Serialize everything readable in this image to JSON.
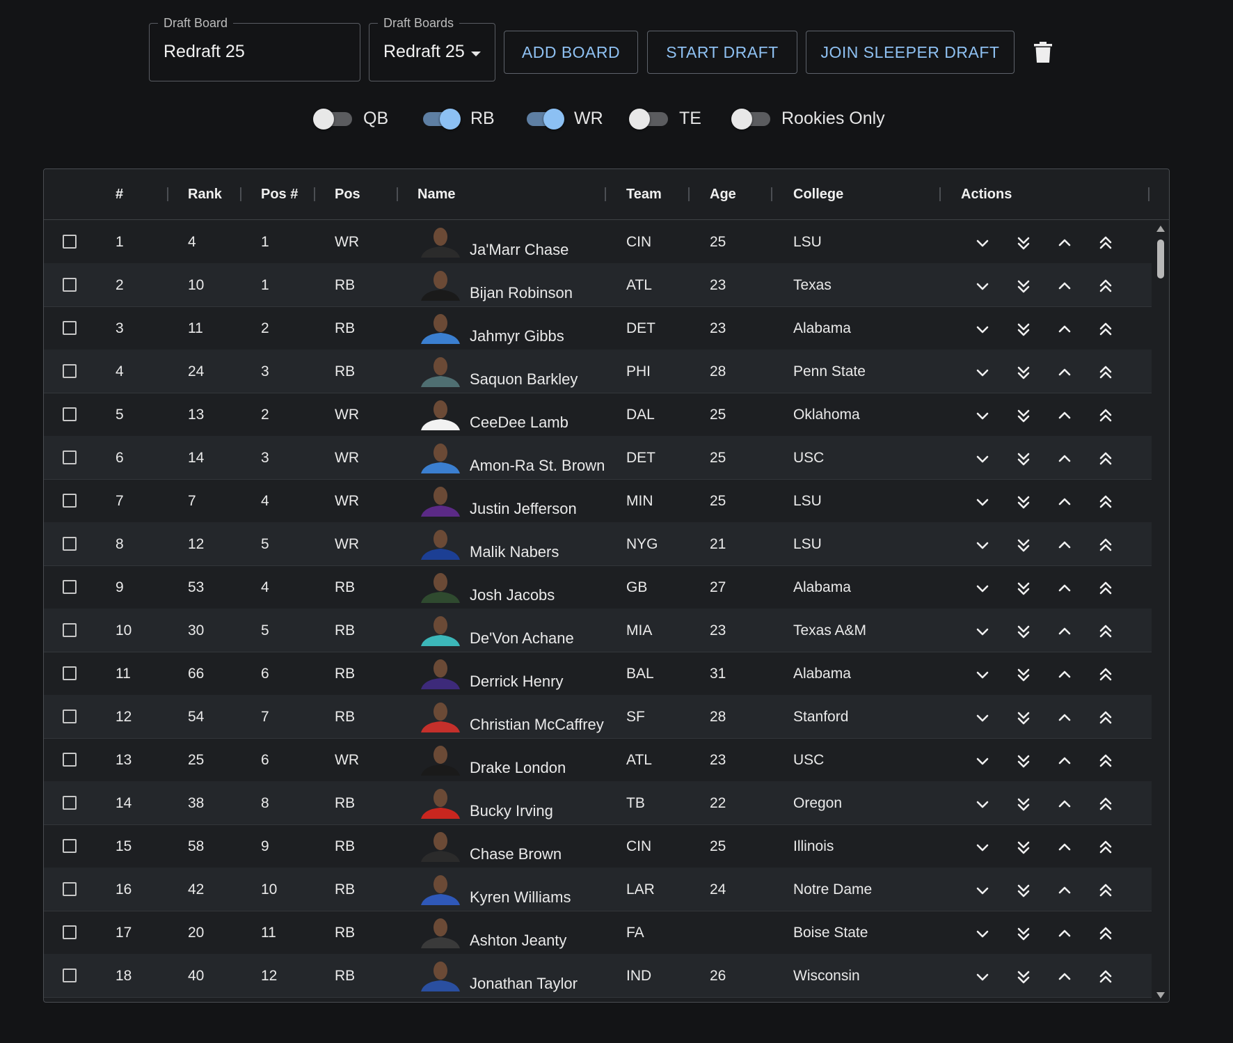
{
  "toolbar": {
    "draft_board_label": "Draft Board",
    "draft_board_value": "Redraft 25",
    "draft_boards_label": "Draft Boards",
    "draft_boards_value": "Redraft 25",
    "add_board": "ADD BOARD",
    "start_draft": "START DRAFT",
    "join_sleeper": "JOIN SLEEPER DRAFT",
    "delete_icon": "trash-icon"
  },
  "filters": [
    {
      "label": "QB",
      "on": false
    },
    {
      "label": "RB",
      "on": true
    },
    {
      "label": "WR",
      "on": true
    },
    {
      "label": "TE",
      "on": false
    },
    {
      "label": "Rookies Only",
      "on": false
    }
  ],
  "table": {
    "headers": [
      "#",
      "Rank",
      "Pos #",
      "Pos",
      "Name",
      "Team",
      "Age",
      "College",
      "Actions"
    ],
    "action_icons": [
      "chevron-down-icon",
      "double-chevron-down-icon",
      "chevron-up-icon",
      "double-chevron-up-icon"
    ],
    "rows": [
      {
        "num": "1",
        "rank": "4",
        "posnum": "1",
        "pos": "WR",
        "name": "Ja'Marr Chase",
        "team": "CIN",
        "age": "25",
        "college": "LSU",
        "jersey": "#2b2b2b"
      },
      {
        "num": "2",
        "rank": "10",
        "posnum": "1",
        "pos": "RB",
        "name": "Bijan Robinson",
        "team": "ATL",
        "age": "23",
        "college": "Texas",
        "jersey": "#1a1a1a"
      },
      {
        "num": "3",
        "rank": "11",
        "posnum": "2",
        "pos": "RB",
        "name": "Jahmyr Gibbs",
        "team": "DET",
        "age": "23",
        "college": "Alabama",
        "jersey": "#3b7fd0"
      },
      {
        "num": "4",
        "rank": "24",
        "posnum": "3",
        "pos": "RB",
        "name": "Saquon Barkley",
        "team": "PHI",
        "age": "28",
        "college": "Penn State",
        "jersey": "#4f6f72"
      },
      {
        "num": "5",
        "rank": "13",
        "posnum": "2",
        "pos": "WR",
        "name": "CeeDee Lamb",
        "team": "DAL",
        "age": "25",
        "college": "Oklahoma",
        "jersey": "#f2f2f2"
      },
      {
        "num": "6",
        "rank": "14",
        "posnum": "3",
        "pos": "WR",
        "name": "Amon-Ra St. Brown",
        "team": "DET",
        "age": "25",
        "college": "USC",
        "jersey": "#3b7fd0"
      },
      {
        "num": "7",
        "rank": "7",
        "posnum": "4",
        "pos": "WR",
        "name": "Justin Jefferson",
        "team": "MIN",
        "age": "25",
        "college": "LSU",
        "jersey": "#5b2a86"
      },
      {
        "num": "8",
        "rank": "12",
        "posnum": "5",
        "pos": "WR",
        "name": "Malik Nabers",
        "team": "NYG",
        "age": "21",
        "college": "LSU",
        "jersey": "#1c3f94"
      },
      {
        "num": "9",
        "rank": "53",
        "posnum": "4",
        "pos": "RB",
        "name": "Josh Jacobs",
        "team": "GB",
        "age": "27",
        "college": "Alabama",
        "jersey": "#2f4a2f"
      },
      {
        "num": "10",
        "rank": "30",
        "posnum": "5",
        "pos": "RB",
        "name": "De'Von Achane",
        "team": "MIA",
        "age": "23",
        "college": "Texas A&M",
        "jersey": "#3cb7b9"
      },
      {
        "num": "11",
        "rank": "66",
        "posnum": "6",
        "pos": "RB",
        "name": "Derrick Henry",
        "team": "BAL",
        "age": "31",
        "college": "Alabama",
        "jersey": "#3d2a7a"
      },
      {
        "num": "12",
        "rank": "54",
        "posnum": "7",
        "pos": "RB",
        "name": "Christian McCaffrey",
        "team": "SF",
        "age": "28",
        "college": "Stanford",
        "jersey": "#c4302b"
      },
      {
        "num": "13",
        "rank": "25",
        "posnum": "6",
        "pos": "WR",
        "name": "Drake London",
        "team": "ATL",
        "age": "23",
        "college": "USC",
        "jersey": "#1a1a1a"
      },
      {
        "num": "14",
        "rank": "38",
        "posnum": "8",
        "pos": "RB",
        "name": "Bucky Irving",
        "team": "TB",
        "age": "22",
        "college": "Oregon",
        "jersey": "#c8261f"
      },
      {
        "num": "15",
        "rank": "58",
        "posnum": "9",
        "pos": "RB",
        "name": "Chase Brown",
        "team": "CIN",
        "age": "25",
        "college": "Illinois",
        "jersey": "#2b2b2b"
      },
      {
        "num": "16",
        "rank": "42",
        "posnum": "10",
        "pos": "RB",
        "name": "Kyren Williams",
        "team": "LAR",
        "age": "24",
        "college": "Notre Dame",
        "jersey": "#2f58b8"
      },
      {
        "num": "17",
        "rank": "20",
        "posnum": "11",
        "pos": "RB",
        "name": "Ashton Jeanty",
        "team": "FA",
        "age": "",
        "college": "Boise State",
        "jersey": "#3a3a3a"
      },
      {
        "num": "18",
        "rank": "40",
        "posnum": "12",
        "pos": "RB",
        "name": "Jonathan Taylor",
        "team": "IND",
        "age": "26",
        "college": "Wisconsin",
        "jersey": "#2a4fa0"
      }
    ]
  }
}
